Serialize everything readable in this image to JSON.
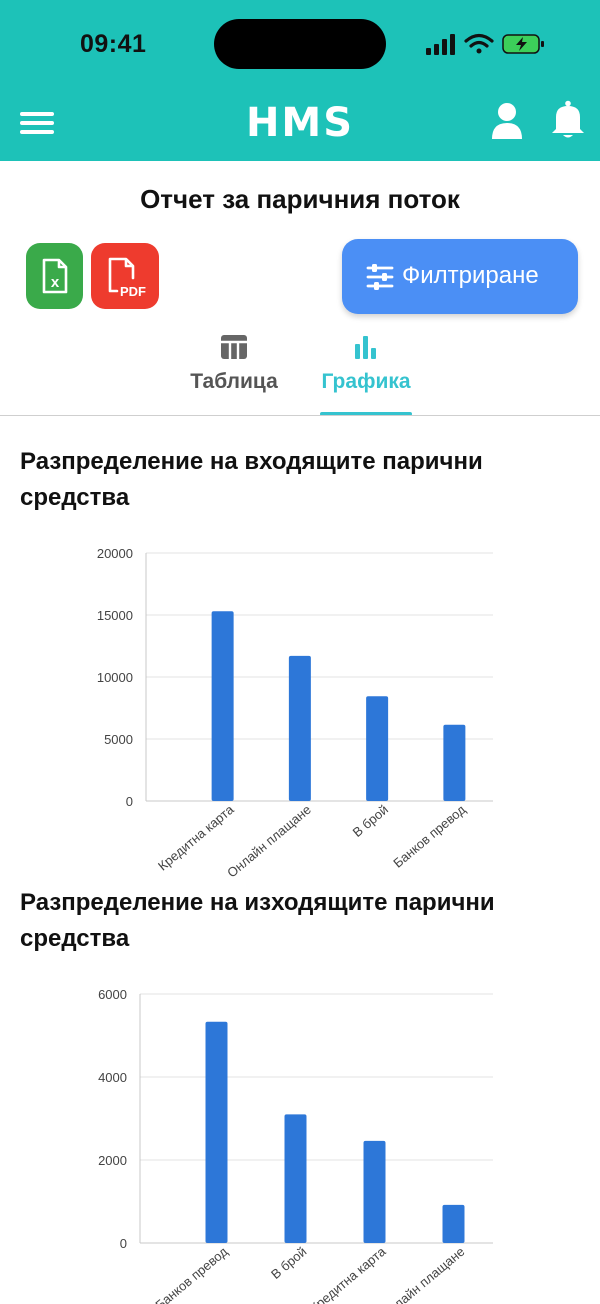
{
  "status_bar": {
    "time": "09:41"
  },
  "header": {
    "logo_text": "HMS",
    "menu_icon": "hamburger-menu-icon",
    "user_icon": "user-icon",
    "bell_icon": "bell-icon",
    "background": "#1dc2b8"
  },
  "page": {
    "title": "Отчет за паричния поток"
  },
  "toolbar": {
    "excel_icon": "excel-file-icon",
    "pdf_icon": "pdf-file-icon",
    "pdf_badge": "PDF",
    "excel_badge": "x",
    "filter_label": "Филтриране",
    "filter_icon": "sliders-icon"
  },
  "tabs": [
    {
      "label": "Таблица",
      "icon": "table-icon",
      "active": false
    },
    {
      "label": "Графика",
      "icon": "bar-chart-icon",
      "active": true
    }
  ],
  "sections": {
    "incoming_title": "Разпределение на входящите парични средства",
    "outgoing_title": "Разпределение на изходящите парични средства"
  },
  "chart_data": [
    {
      "type": "bar",
      "categories": [
        "Кредитна карта",
        "Онлайн плащане",
        "В брой",
        "Банков превод"
      ],
      "values": [
        15300,
        11700,
        8450,
        6150
      ],
      "title": "Разпределение на входящите парични средства",
      "ylim": [
        0,
        20000
      ],
      "yticks": [
        0,
        5000,
        10000,
        15000,
        20000
      ],
      "bar_color": "#2d77d8",
      "grid": true
    },
    {
      "type": "bar",
      "categories": [
        "Банков превод",
        "В брой",
        "Кредитна карта",
        "Онлайн плащане"
      ],
      "values": [
        5330,
        3100,
        2460,
        920
      ],
      "title": "Разпределение на изходящите парични средства",
      "ylim": [
        0,
        6000
      ],
      "yticks": [
        0,
        2000,
        4000,
        6000
      ],
      "bar_color": "#2d77d8",
      "grid": true
    }
  ]
}
